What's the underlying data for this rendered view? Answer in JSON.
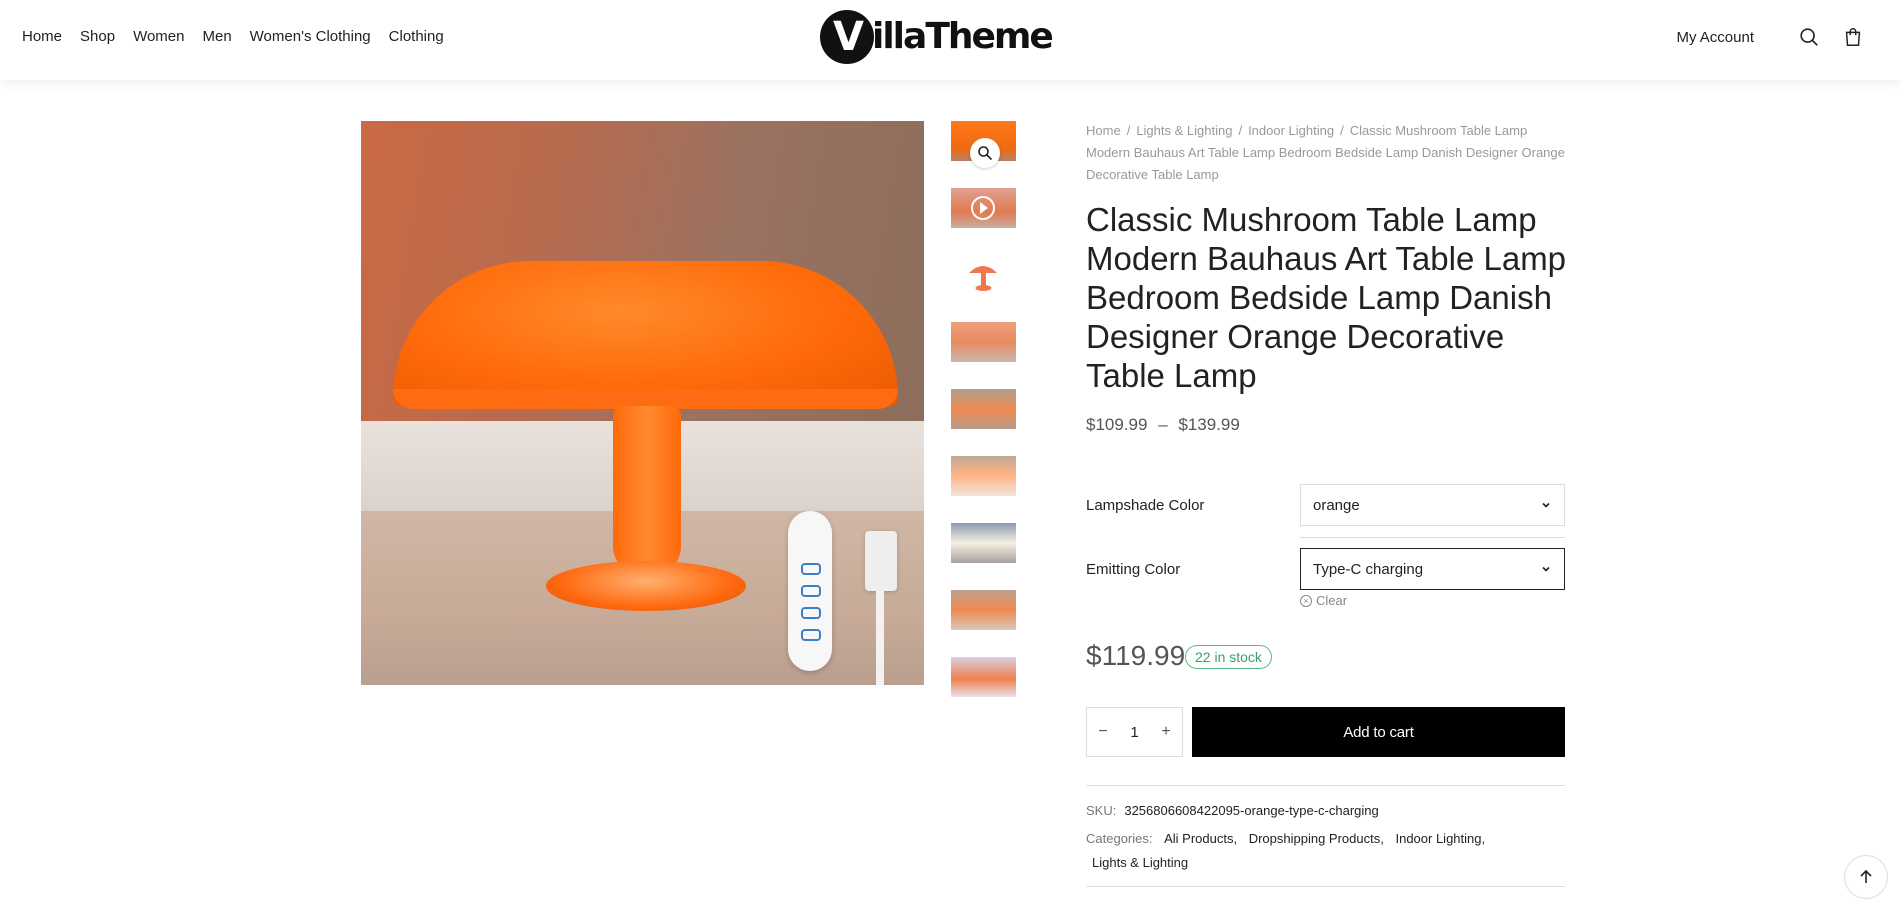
{
  "header": {
    "nav": [
      "Home",
      "Shop",
      "Women",
      "Men",
      "Women's Clothing",
      "Clothing"
    ],
    "logo_text": "VillaTheme",
    "account_label": "My Account",
    "icons": [
      "search-icon",
      "cart-icon"
    ]
  },
  "breadcrumb": {
    "items": [
      "Home",
      "Lights & Lighting",
      "Indoor Lighting"
    ],
    "current": "Classic Mushroom Table Lamp Modern Bauhaus Art Table Lamp Bedroom Bedside Lamp Danish Designer Orange Decorative Table Lamp"
  },
  "product": {
    "title": "Classic Mushroom Table Lamp Modern Bauhaus Art Table Lamp Bedroom Bedside Lamp Danish Designer Orange Decorative Table Lamp",
    "price_range_low": "$109.99",
    "price_range_sep": "–",
    "price_range_high": "$139.99",
    "variations": [
      {
        "label": "Lampshade Color",
        "value": "orange"
      },
      {
        "label": "Emitting Color",
        "value": "Type-C charging"
      }
    ],
    "clear_label": "Clear",
    "price": "$119.99",
    "stock": "22 in stock",
    "quantity": "1",
    "add_to_cart_label": "Add to cart",
    "sku_label": "SKU:",
    "sku": "3256806608422095-orange-type-c-charging",
    "categories_label": "Categories:",
    "categories": [
      "Ali Products,",
      "Dropshipping Products,",
      "Indoor Lighting,",
      "Lights & Lighting"
    ]
  },
  "colors": {
    "accent": "#000000",
    "stock_green": "#3e9e6a",
    "lamp_orange": "#ff6a0a"
  }
}
